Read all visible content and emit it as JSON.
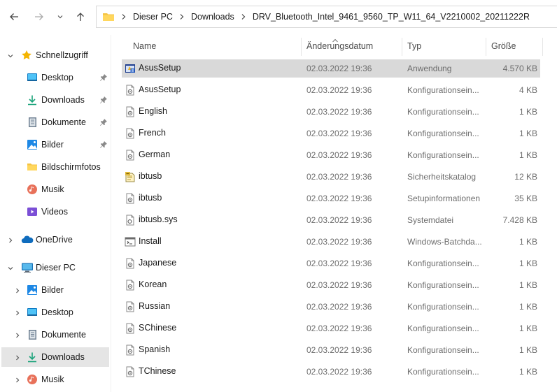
{
  "address": {
    "segments": [
      "Dieser PC",
      "Downloads",
      "DRV_Bluetooth_Intel_9461_9560_TP_W11_64_V2210002_20211222R"
    ]
  },
  "sidebar": {
    "quick_access": {
      "label": "Schnellzugriff",
      "items": [
        {
          "label": "Desktop",
          "icon": "desktop-icon",
          "pinned": true
        },
        {
          "label": "Downloads",
          "icon": "download-icon",
          "pinned": true
        },
        {
          "label": "Dokumente",
          "icon": "document-icon",
          "pinned": true
        },
        {
          "label": "Bilder",
          "icon": "pictures-icon",
          "pinned": true
        },
        {
          "label": "Bildschirmfotos",
          "icon": "folder-icon",
          "pinned": false
        },
        {
          "label": "Musik",
          "icon": "music-icon",
          "pinned": false
        },
        {
          "label": "Videos",
          "icon": "videos-icon",
          "pinned": false
        }
      ]
    },
    "onedrive": {
      "label": "OneDrive"
    },
    "this_pc": {
      "label": "Dieser PC",
      "items": [
        {
          "label": "Bilder",
          "icon": "pictures-icon"
        },
        {
          "label": "Desktop",
          "icon": "desktop-icon"
        },
        {
          "label": "Dokumente",
          "icon": "document-icon"
        },
        {
          "label": "Downloads",
          "icon": "download-icon",
          "selected": true
        },
        {
          "label": "Musik",
          "icon": "music-icon"
        }
      ]
    }
  },
  "columns": {
    "name": "Name",
    "date": "Änderungsdatum",
    "type": "Typ",
    "size": "Größe"
  },
  "files": [
    {
      "name": "AsusSetup",
      "date": "02.03.2022 19:36",
      "type": "Anwendung",
      "size": "4.570 KB",
      "icon": "application-icon",
      "selected": true
    },
    {
      "name": "AsusSetup",
      "date": "02.03.2022 19:36",
      "type": "Konfigurationsein...",
      "size": "4 KB",
      "icon": "config-file-icon"
    },
    {
      "name": "English",
      "date": "02.03.2022 19:36",
      "type": "Konfigurationsein...",
      "size": "1 KB",
      "icon": "config-file-icon"
    },
    {
      "name": "French",
      "date": "02.03.2022 19:36",
      "type": "Konfigurationsein...",
      "size": "1 KB",
      "icon": "config-file-icon"
    },
    {
      "name": "German",
      "date": "02.03.2022 19:36",
      "type": "Konfigurationsein...",
      "size": "1 KB",
      "icon": "config-file-icon"
    },
    {
      "name": "ibtusb",
      "date": "02.03.2022 19:36",
      "type": "Sicherheitskatalog",
      "size": "12 KB",
      "icon": "security-catalog-icon"
    },
    {
      "name": "ibtusb",
      "date": "02.03.2022 19:36",
      "type": "Setupinformationen",
      "size": "35 KB",
      "icon": "config-file-icon"
    },
    {
      "name": "ibtusb.sys",
      "date": "02.03.2022 19:36",
      "type": "Systemdatei",
      "size": "7.428 KB",
      "icon": "system-file-icon"
    },
    {
      "name": "Install",
      "date": "02.03.2022 19:36",
      "type": "Windows-Batchda...",
      "size": "1 KB",
      "icon": "batch-file-icon"
    },
    {
      "name": "Japanese",
      "date": "02.03.2022 19:36",
      "type": "Konfigurationsein...",
      "size": "1 KB",
      "icon": "config-file-icon"
    },
    {
      "name": "Korean",
      "date": "02.03.2022 19:36",
      "type": "Konfigurationsein...",
      "size": "1 KB",
      "icon": "config-file-icon"
    },
    {
      "name": "Russian",
      "date": "02.03.2022 19:36",
      "type": "Konfigurationsein...",
      "size": "1 KB",
      "icon": "config-file-icon"
    },
    {
      "name": "SChinese",
      "date": "02.03.2022 19:36",
      "type": "Konfigurationsein...",
      "size": "1 KB",
      "icon": "config-file-icon"
    },
    {
      "name": "Spanish",
      "date": "02.03.2022 19:36",
      "type": "Konfigurationsein...",
      "size": "1 KB",
      "icon": "config-file-icon"
    },
    {
      "name": "TChinese",
      "date": "02.03.2022 19:36",
      "type": "Konfigurationsein...",
      "size": "1 KB",
      "icon": "config-file-icon"
    }
  ]
}
